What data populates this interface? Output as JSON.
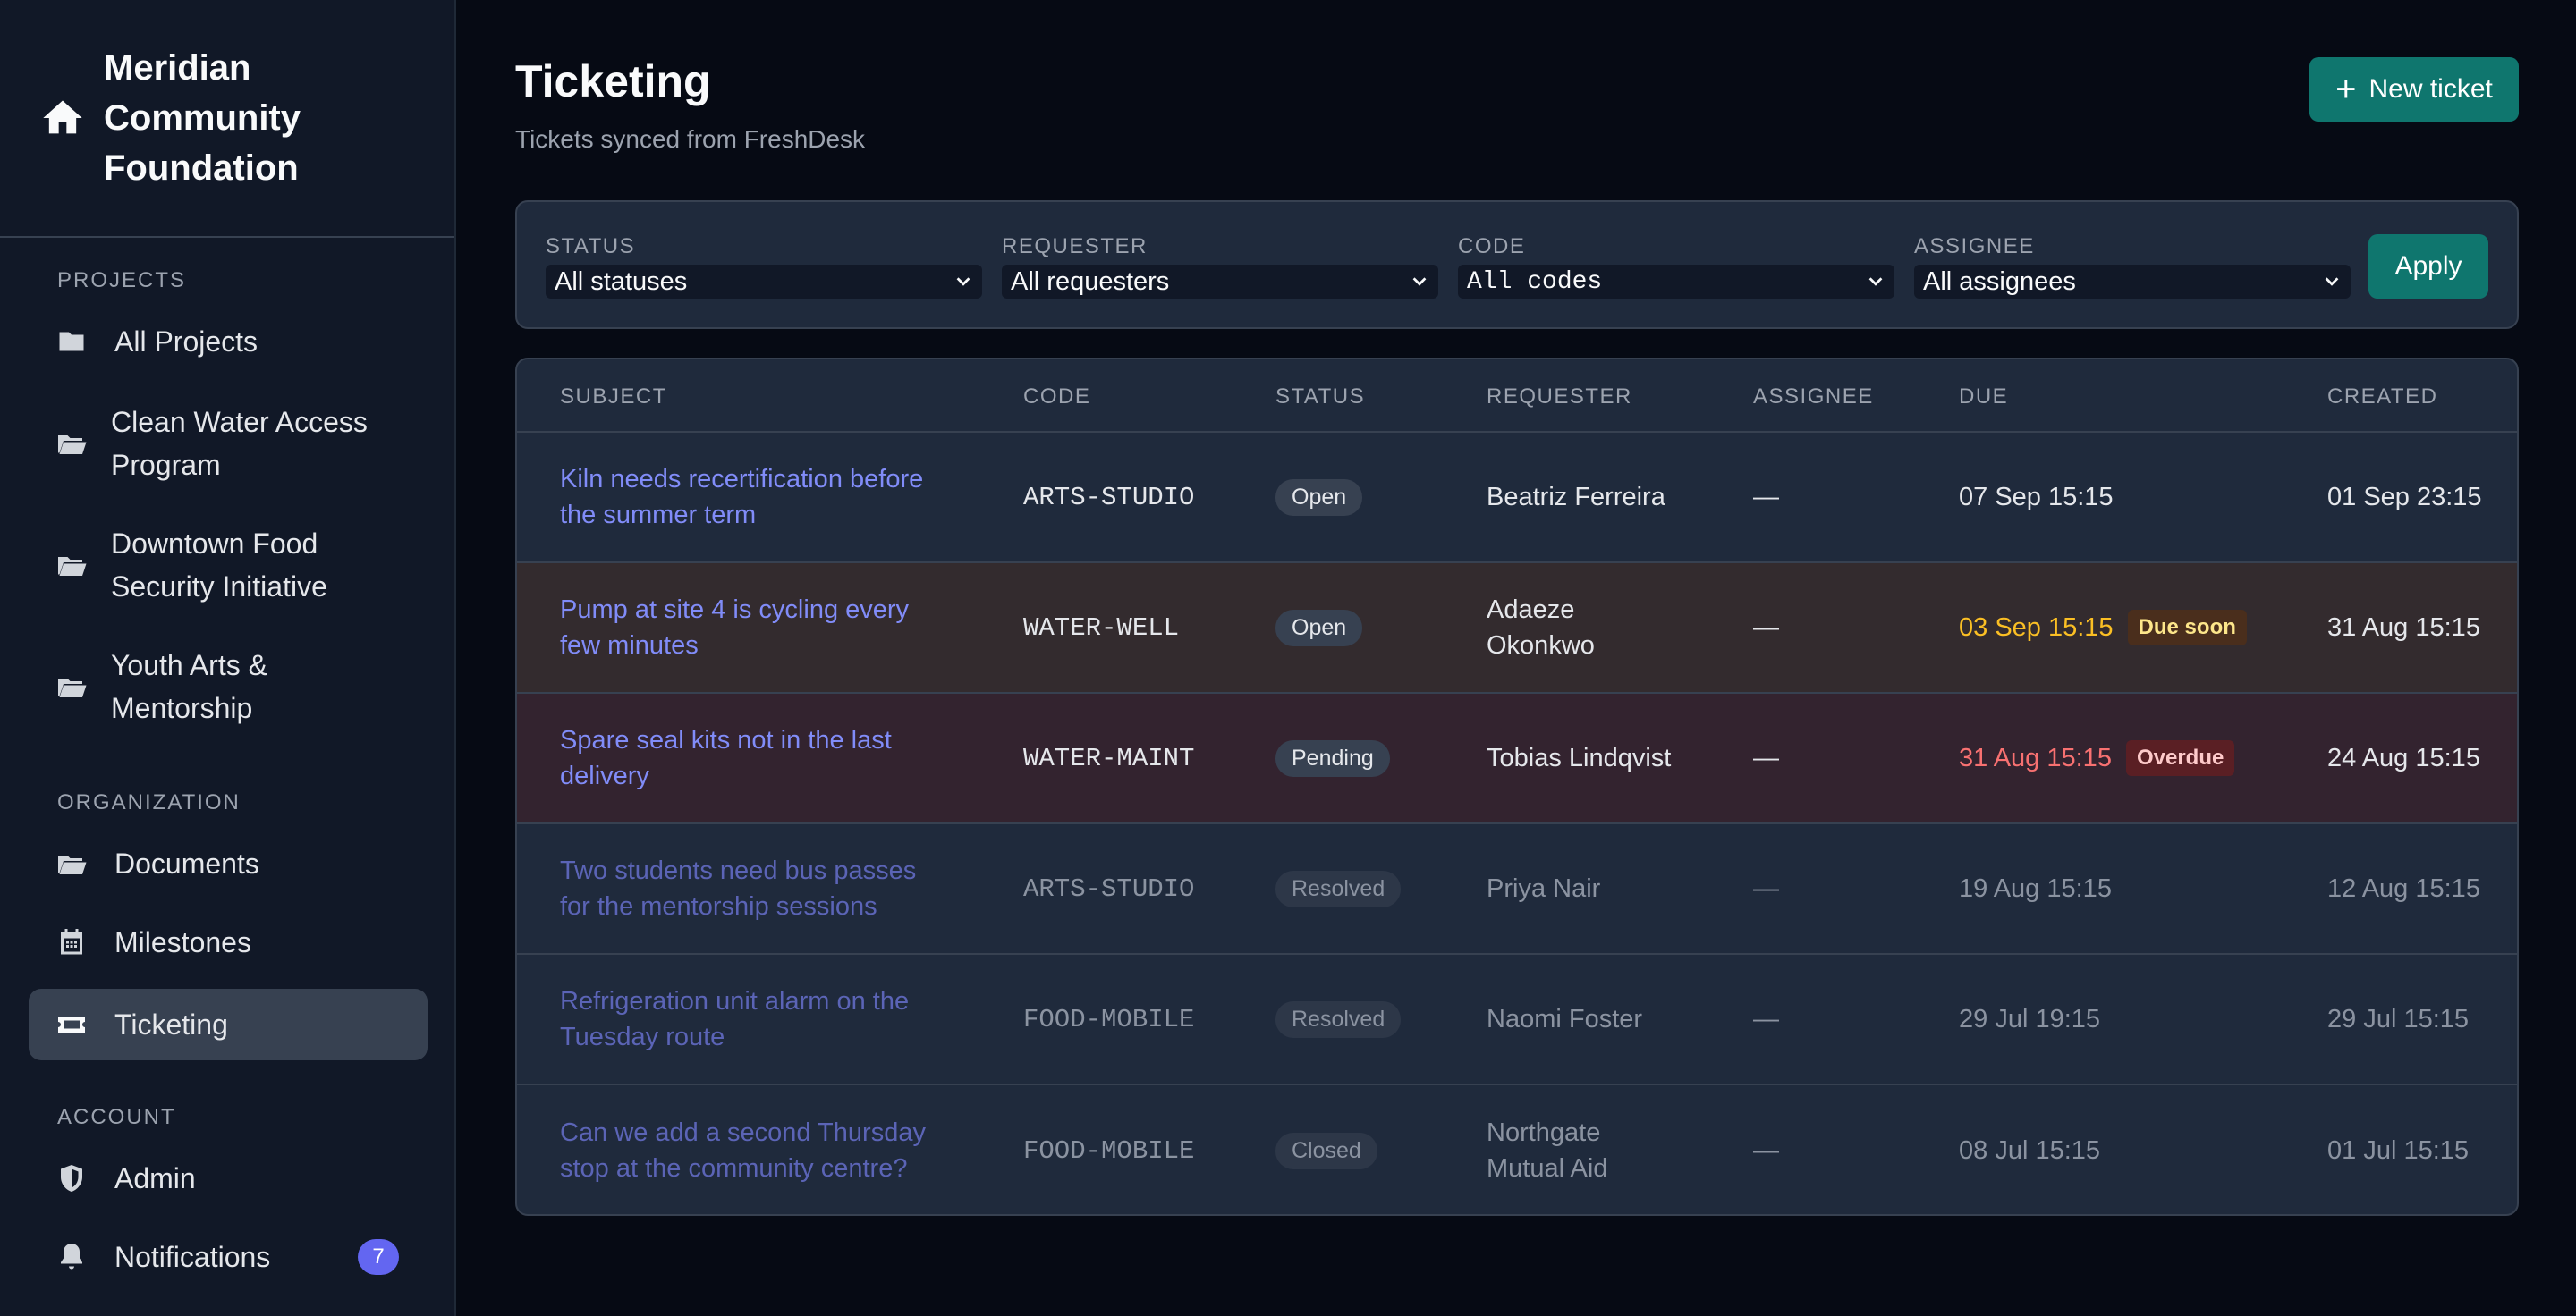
{
  "org": {
    "name": "Meridian Community Foundation",
    "icon": "home-icon"
  },
  "nav": {
    "projects_heading": "PROJECTS",
    "projects": [
      {
        "label": "All Projects",
        "icon": "folder-icon"
      },
      {
        "label": "Clean Water Access Program",
        "icon": "folder-open-icon"
      },
      {
        "label": "Downtown Food Security Initiative",
        "icon": "folder-open-icon"
      },
      {
        "label": "Youth Arts & Mentorship",
        "icon": "folder-open-icon"
      }
    ],
    "organization_heading": "ORGANIZATION",
    "organization": [
      {
        "label": "Documents",
        "icon": "folder-open-icon"
      },
      {
        "label": "Milestones",
        "icon": "calendar-icon"
      },
      {
        "label": "Ticketing",
        "icon": "ticket-icon",
        "active": true
      }
    ],
    "account_heading": "ACCOUNT",
    "account": [
      {
        "label": "Admin",
        "icon": "shield-icon"
      },
      {
        "label": "Notifications",
        "icon": "bell-icon",
        "badge": "7"
      }
    ]
  },
  "header": {
    "title": "Ticketing",
    "subtitle": "Tickets synced from FreshDesk",
    "new_ticket_label": "New ticket"
  },
  "filters": {
    "status": {
      "label": "STATUS",
      "value": "All statuses"
    },
    "requester": {
      "label": "REQUESTER",
      "value": "All requesters"
    },
    "code": {
      "label": "CODE",
      "value": "All codes"
    },
    "assignee": {
      "label": "ASSIGNEE",
      "value": "All assignees"
    },
    "apply_label": "Apply"
  },
  "table": {
    "columns": [
      "SUBJECT",
      "CODE",
      "STATUS",
      "REQUESTER",
      "ASSIGNEE",
      "DUE",
      "CREATED"
    ],
    "rows": [
      {
        "subject": "Kiln needs recertification before the summer term",
        "code": "ARTS-STUDIO",
        "status": "Open",
        "requester": "Beatriz Ferreira",
        "assignee": "—",
        "due": "07 Sep 15:15",
        "due_flag": "",
        "created": "01 Sep 23:15"
      },
      {
        "subject": "Pump at site 4 is cycling every few minutes",
        "code": "WATER-WELL",
        "status": "Open",
        "requester": "Adaeze Okonkwo",
        "assignee": "—",
        "due": "03 Sep 15:15",
        "due_flag": "Due soon",
        "created": "31 Aug 15:15"
      },
      {
        "subject": "Spare seal kits not in the last delivery",
        "code": "WATER-MAINT",
        "status": "Pending",
        "requester": "Tobias Lindqvist",
        "assignee": "—",
        "due": "31 Aug 15:15",
        "due_flag": "Overdue",
        "created": "24 Aug 15:15"
      },
      {
        "subject": "Two students need bus passes for the mentorship sessions",
        "code": "ARTS-STUDIO",
        "status": "Resolved",
        "requester": "Priya Nair",
        "assignee": "—",
        "due": "19 Aug 15:15",
        "due_flag": "",
        "created": "12 Aug 15:15"
      },
      {
        "subject": "Refrigeration unit alarm on the Tuesday route",
        "code": "FOOD-MOBILE",
        "status": "Resolved",
        "requester": "Naomi Foster",
        "assignee": "—",
        "due": "29 Jul 19:15",
        "due_flag": "",
        "created": "29 Jul 15:15"
      },
      {
        "subject": "Can we add a second Thursday stop at the community centre?",
        "code": "FOOD-MOBILE",
        "status": "Closed",
        "requester": "Northgate Mutual Aid",
        "assignee": "—",
        "due": "08 Jul 15:15",
        "due_flag": "",
        "created": "01 Jul 15:15"
      }
    ]
  },
  "colors": {
    "accent": "#0f766e",
    "link": "#818cf8",
    "due_soon": "#fbbf24",
    "overdue": "#f87171",
    "badge": "#6366f1"
  }
}
